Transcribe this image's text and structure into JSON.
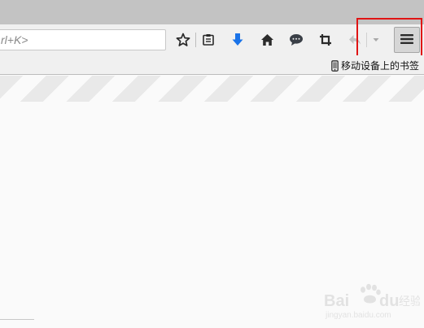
{
  "search": {
    "placeholder": "rl+K>"
  },
  "toolbar": {
    "buttons": [
      {
        "icon": "star-icon"
      },
      {
        "icon": "reading-list-icon"
      },
      {
        "icon": "download-arrow-icon",
        "color": "#1a73e8"
      },
      {
        "icon": "home-icon"
      },
      {
        "icon": "chat-bubble-icon"
      },
      {
        "icon": "crop-icon"
      },
      {
        "icon": "back-arrow-icon"
      },
      {
        "icon": "dropdown-arrow-icon"
      },
      {
        "icon": "hamburger-menu-icon"
      }
    ],
    "highlight_color": "#e01414"
  },
  "bookmarks": {
    "mobile_bookmarks_label": "移动设备上的书签",
    "icon": "mobile-phone-icon"
  },
  "watermark": {
    "logo_text": "Baidu经验",
    "url_text": "jingyan.baidu.com"
  }
}
